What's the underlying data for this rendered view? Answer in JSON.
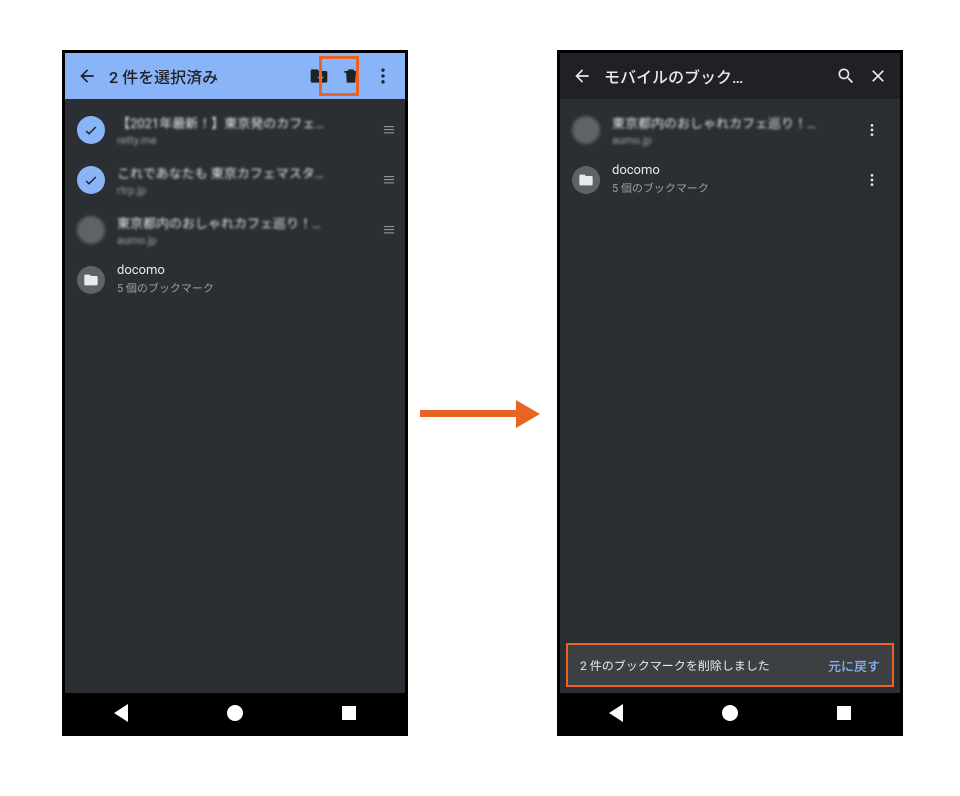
{
  "colors": {
    "accent": "#8ab4f8",
    "highlight": "#e96424",
    "bg": "#2b2f34"
  },
  "left": {
    "toolbar_title": "2 件を選択済み",
    "items": [
      {
        "title": "【2021年最新！】東京発のカフェ…",
        "sub": "retty.me",
        "selected": true,
        "drag": true
      },
      {
        "title": "これであなたも 東京カフェマスタ…",
        "sub": "rtrp.jp",
        "selected": true,
        "drag": true
      },
      {
        "title": "東京都内のおしゃれカフェ巡り！…",
        "sub": "aumo.jp",
        "selected": false,
        "drag": true
      },
      {
        "title": "docomo",
        "sub": "5 個のブックマーク",
        "folder": true
      }
    ]
  },
  "right": {
    "toolbar_title": "モバイルのブック…",
    "items": [
      {
        "title": "東京都内のおしゃれカフェ巡り！…",
        "sub": "aumo.jp"
      },
      {
        "title": "docomo",
        "sub": "5 個のブックマーク",
        "folder": true
      }
    ],
    "snackbar": {
      "message": "2 件のブックマークを削除しました",
      "action": "元に戻す"
    }
  }
}
